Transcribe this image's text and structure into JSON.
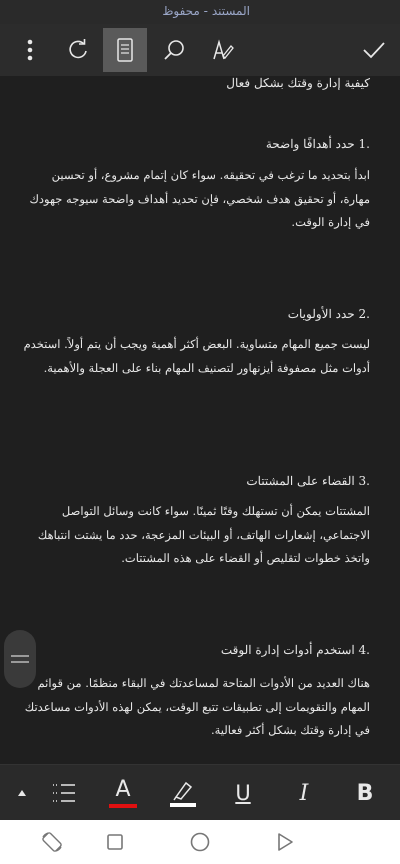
{
  "window": {
    "title": "المستند - محفوظ"
  },
  "toolbar": {
    "icons": [
      "more-vert-icon",
      "redo-icon",
      "mobile-view-icon",
      "search-icon",
      "draw-icon",
      "check-icon"
    ]
  },
  "document": {
    "intro": "كيفية إدارة وقتك بشكل فعال",
    "sections": [
      {
        "heading": ".1 حدد أهدافًا واضحة",
        "body": "ابدأ بتحديد ما ترغب في تحقيقه. سواء كان إتمام مشروع، أو تحسين مهارة، أو تحقيق هدف شخصي، فإن تحديد أهداف واضحة سيوجه جهودك في إدارة الوقت."
      },
      {
        "heading": ".2 حدد الأولويات",
        "body": "ليست جميع المهام متساوية. البعض أكثر أهمية ويجب أن يتم أولاً. استخدم أدوات مثل مصفوفة أيزنهاور لتصنيف المهام بناء على العجلة والأهمية."
      },
      {
        "heading": ".3 القضاء على المشتتات",
        "body": "المشتتات يمكن أن تستهلك وقتًا ثمينًا. سواء كانت وسائل التواصل الاجتماعي، إشعارات الهاتف، أو البيئات المزعجة، حدد ما يشتت انتباهك واتخذ خطوات لتقليص أو القضاء على هذه المشتتات."
      },
      {
        "heading": ".4 استخدم أدوات إدارة الوقت",
        "body": "هناك العديد من الأدوات المتاحة لمساعدتك في البقاء منظمًا. من قوائم المهام والتقويمات إلى تطبيقات تتبع الوقت، يمكن لهذه الأدوات مساعدتك في إدارة وقتك بشكل أكثر فعالية."
      }
    ]
  },
  "format_bar": {
    "font_color_label": "A",
    "underline_label": "U",
    "italic_label": "I",
    "bold_label": "B",
    "font_color": "#e01010",
    "highlight_color": "#ffffff"
  },
  "navbar": {
    "icons": [
      "rotate-icon",
      "recents-icon",
      "home-icon",
      "back-icon"
    ]
  }
}
